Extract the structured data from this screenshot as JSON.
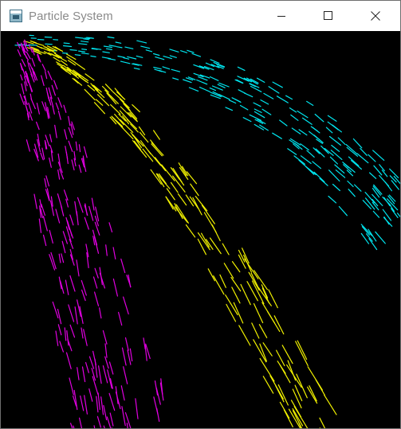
{
  "window": {
    "title": "Particle System",
    "controls": {
      "minimize": "minimize-icon",
      "maximize": "maximize-icon",
      "close": "close-icon"
    }
  },
  "particles": {
    "colors": {
      "cyan": "#00e5ef",
      "yellow": "#f0f000",
      "magenta": "#e000e0"
    },
    "streams": [
      "cyan",
      "yellow",
      "magenta"
    ]
  }
}
